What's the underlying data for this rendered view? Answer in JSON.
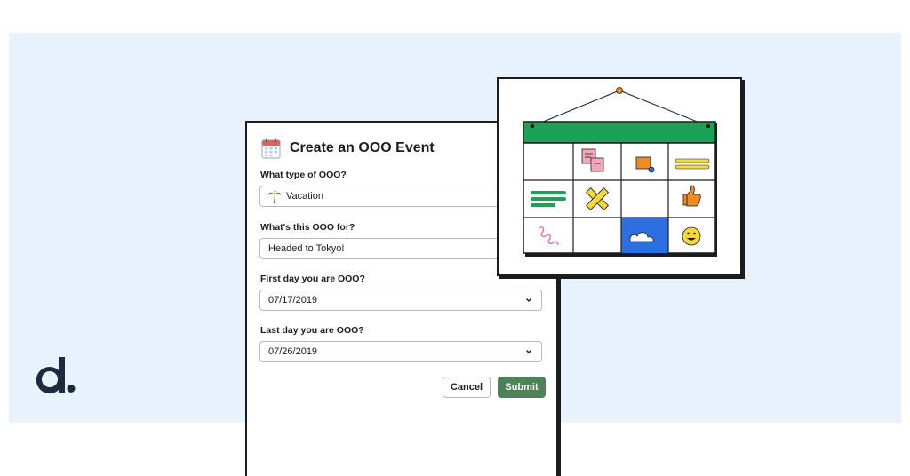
{
  "dialog": {
    "title": "Create an OOO Event",
    "title_icon": "calendar-icon",
    "type_label": "What type of OOO?",
    "type_value": "Vacation",
    "type_icon": "palm-tree-icon",
    "purpose_label": "What's this OOO for?",
    "purpose_value": "Headed to Tokyo!",
    "first_day_label": "First day you are OOO?",
    "first_day_value": "07/17/2019",
    "last_day_label": "Last day you are OOO?",
    "last_day_value": "07/26/2019",
    "cancel_label": "Cancel",
    "submit_label": "Submit"
  },
  "colors": {
    "background": "#e8f2fc",
    "submit": "#4f8158",
    "calendar_header": "#1aa357",
    "logo": "#1d2b3e",
    "highlight_cell": "#2d6fe0"
  },
  "calendar_illustration": {
    "icons": [
      "notes-icon",
      "sticky-note-icon",
      "yellow-lines-icon",
      "green-lines-icon",
      "x-mark-icon",
      "thumbs-up-icon",
      "squiggle-icon",
      "cloud-icon",
      "smiley-icon"
    ]
  }
}
